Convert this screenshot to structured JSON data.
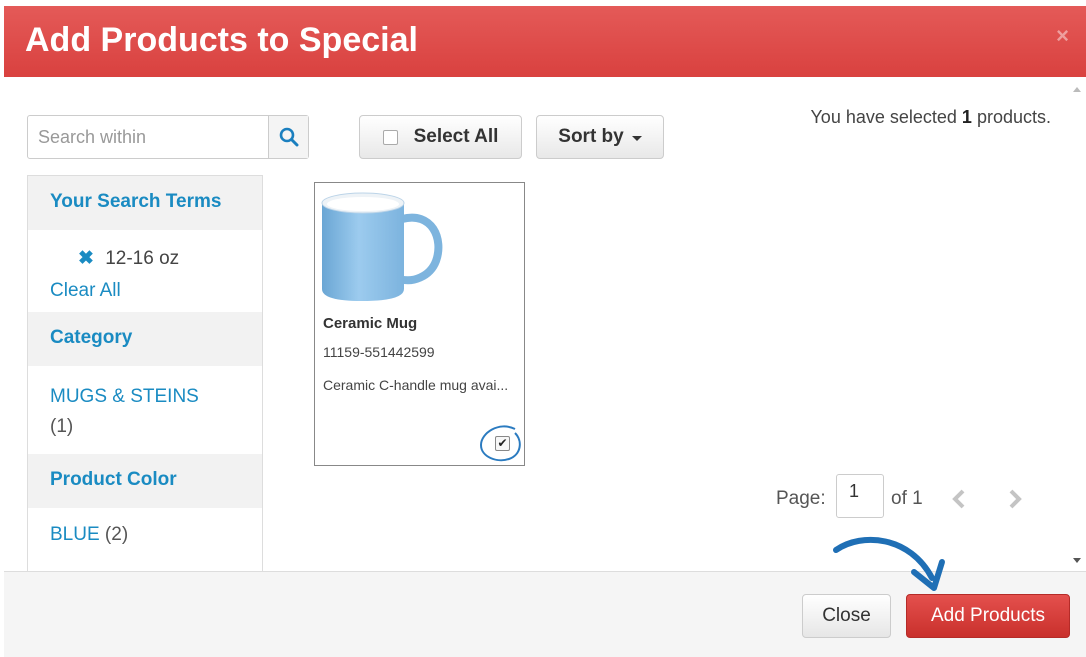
{
  "modal": {
    "title": "Add Products to Special",
    "close_glyph": "×"
  },
  "search": {
    "placeholder": "Search within",
    "icon": "search-icon"
  },
  "toolbar": {
    "select_all_label": "Select All",
    "sort_by_label": "Sort by"
  },
  "selection": {
    "prefix": "You have selected",
    "count": "1",
    "suffix": "products."
  },
  "sidebar": {
    "search_terms_heading": "Your Search Terms",
    "terms": [
      {
        "remove_glyph": "✖",
        "label": "12-16 oz"
      }
    ],
    "clear_all_label": "Clear All",
    "category_heading": "Category",
    "categories": [
      {
        "label": "MUGS & STEINS",
        "count": "(1)"
      }
    ],
    "color_heading": "Product Color",
    "colors": [
      {
        "label": "BLUE",
        "count": "(2)"
      }
    ]
  },
  "products": [
    {
      "name": "Ceramic Mug",
      "sku": "11159-551442599",
      "description": "Ceramic C-handle mug avai...",
      "checked": true,
      "check_glyph": "✔",
      "image_color": "#8dbfe4"
    }
  ],
  "pager": {
    "page_label": "Page:",
    "current_page": "1",
    "of_label": "of 1"
  },
  "footer": {
    "close_label": "Close",
    "add_label": "Add Products"
  },
  "colors": {
    "header_red": "#d9413f",
    "link_blue": "#1a8bc2",
    "annotation_blue": "#2b7bc0",
    "primary_button": "#c9302c"
  }
}
